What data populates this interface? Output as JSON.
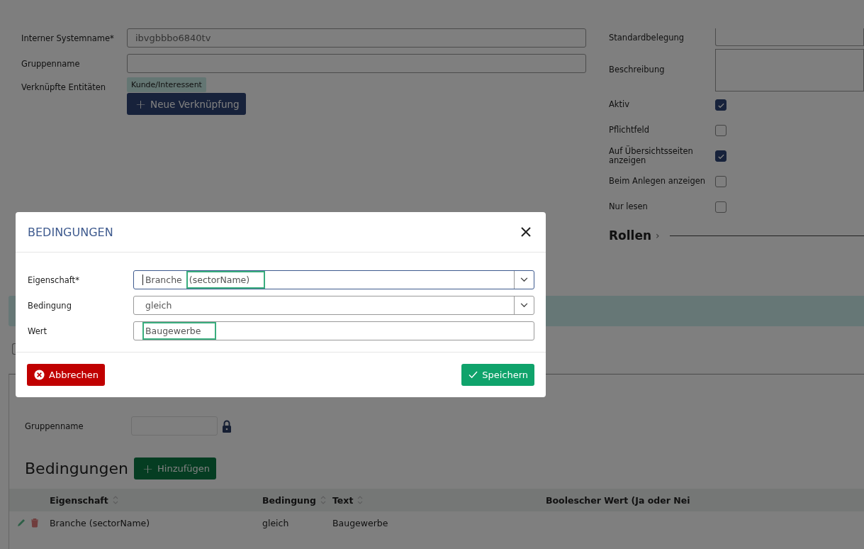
{
  "form": {
    "left_fields": [
      {
        "kind": "input",
        "label": "Interner Systemname*",
        "value": "ibvgbbbo6840tv"
      },
      {
        "kind": "input",
        "label": "Gruppenname"
      },
      {
        "kind": "tags",
        "label": "Verknüpfte Entitäten",
        "tags": [
          "Kunde/Interessent"
        ],
        "button_icon": "+",
        "button": "Neue Verknüpfung"
      }
    ],
    "right_fields": [
      {
        "kind": "input",
        "label": "Standardbelegung"
      },
      {
        "kind": "textarea",
        "label": "Beschreibung"
      },
      {
        "kind": "checkbox",
        "label": "Aktiv",
        "checked": true
      },
      {
        "kind": "checkbox",
        "label": "Pflichtfeld",
        "checked": false
      },
      {
        "kind": "checkbox",
        "label": "Auf Übersichtsseiten anzeigen",
        "checked": true
      },
      {
        "kind": "checkbox",
        "label": "Beim Anlegen anzeigen",
        "checked": false
      },
      {
        "kind": "checkbox",
        "label": "Nur lesen",
        "checked": false
      }
    ],
    "section_title": "Rollen",
    "section_caret": "›"
  },
  "lower": {
    "checkbox": {
      "checked": false
    },
    "group_label": "Gruppenname",
    "heading": "Bedingungen",
    "add_button_icon": "+",
    "add_button": "Hinzufügen",
    "table": {
      "columns": [
        "Eigenschaft",
        "Bedingung",
        "Text",
        "Boolescher Wert (Ja oder Nei"
      ],
      "rows": [
        {
          "cells": [
            "Branche (sectorName)",
            "gleich",
            "Baugewerbe",
            ""
          ]
        }
      ]
    }
  },
  "dialog": {
    "title": "BEDINGUNGEN",
    "fields": [
      {
        "kind": "select",
        "label": "Eigenschaft*",
        "focused": true,
        "value_parts": [
          {
            "text": "Branche",
            "highlighted": false
          },
          {
            "text": "(sectorName)",
            "highlighted": true
          }
        ]
      },
      {
        "kind": "select",
        "label": "Bedingung",
        "focused": false,
        "value_parts": [
          {
            "text": "gleich",
            "highlighted": false
          }
        ]
      },
      {
        "kind": "input",
        "label": "Wert",
        "focused": false,
        "value_parts": [
          {
            "text": "Baugewerbe",
            "highlighted": true
          }
        ]
      }
    ],
    "cancel": "Abbrechen",
    "save": "Speichern"
  }
}
